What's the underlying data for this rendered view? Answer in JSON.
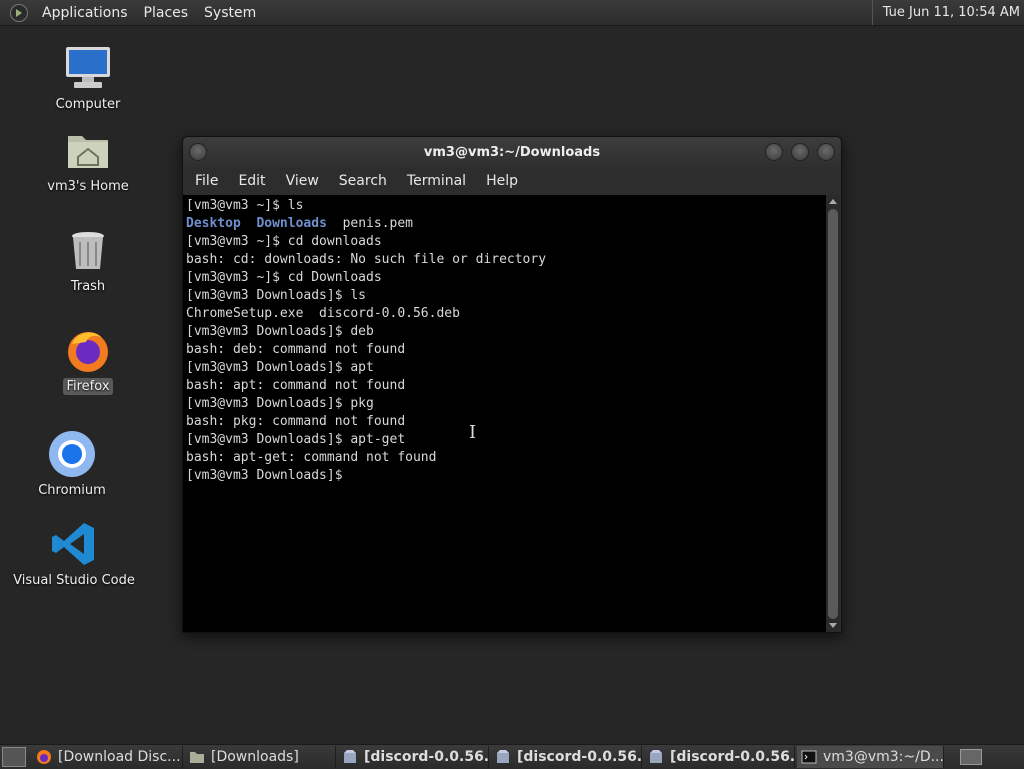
{
  "top_panel": {
    "menus": [
      "Applications",
      "Places",
      "System"
    ],
    "clock": "Tue Jun 11, 10:54 AM"
  },
  "desktop_icons": [
    {
      "label": "Computer",
      "icon": "computer-icon"
    },
    {
      "label": "vm3's Home",
      "icon": "home-folder-icon"
    },
    {
      "label": "Trash",
      "icon": "trash-icon"
    },
    {
      "label": "Firefox",
      "icon": "firefox-icon",
      "selected": true
    },
    {
      "label": "Chromium",
      "icon": "chromium-icon"
    },
    {
      "label": "Visual Studio Code",
      "icon": "vscode-icon"
    }
  ],
  "terminal_window": {
    "title": "vm3@vm3:~/Downloads",
    "menu": [
      "File",
      "Edit",
      "View",
      "Search",
      "Terminal",
      "Help"
    ],
    "lines": [
      "[vm3@vm3 ~]$ ls",
      "Desktop  Downloads  penis.pem",
      "[vm3@vm3 ~]$ cd downloads",
      "bash: cd: downloads: No such file or directory",
      "[vm3@vm3 ~]$ cd Downloads",
      "[vm3@vm3 Downloads]$ ls",
      "ChromeSetup.exe  discord-0.0.56.deb",
      "[vm3@vm3 Downloads]$ deb",
      "bash: deb: command not found",
      "[vm3@vm3 Downloads]$ apt",
      "bash: apt: command not found",
      "[vm3@vm3 Downloads]$ pkg",
      "bash: pkg: command not found",
      "[vm3@vm3 Downloads]$ apt-get",
      "bash: apt-get: command not found",
      "[vm3@vm3 Downloads]$ "
    ],
    "ls_dirs": [
      "Desktop",
      "Downloads"
    ],
    "ls_file": "penis.pem"
  },
  "taskbar": {
    "tasks": [
      {
        "label": "[Download Disc...",
        "icon": "firefox-icon",
        "bold": false
      },
      {
        "label": "[Downloads]",
        "icon": "folder-icon",
        "bold": false
      },
      {
        "label": "[discord-0.0.56...",
        "icon": "package-icon",
        "bold": true
      },
      {
        "label": "[discord-0.0.56...",
        "icon": "package-icon",
        "bold": true
      },
      {
        "label": "[discord-0.0.56...",
        "icon": "package-icon",
        "bold": true
      },
      {
        "label": "vm3@vm3:~/D...",
        "icon": "terminal-icon",
        "bold": false,
        "active": true
      }
    ]
  },
  "colors": {
    "terminal_bg": "#000000",
    "dir_blue": "#6f8fcf",
    "panel": "#2c2c2c"
  }
}
